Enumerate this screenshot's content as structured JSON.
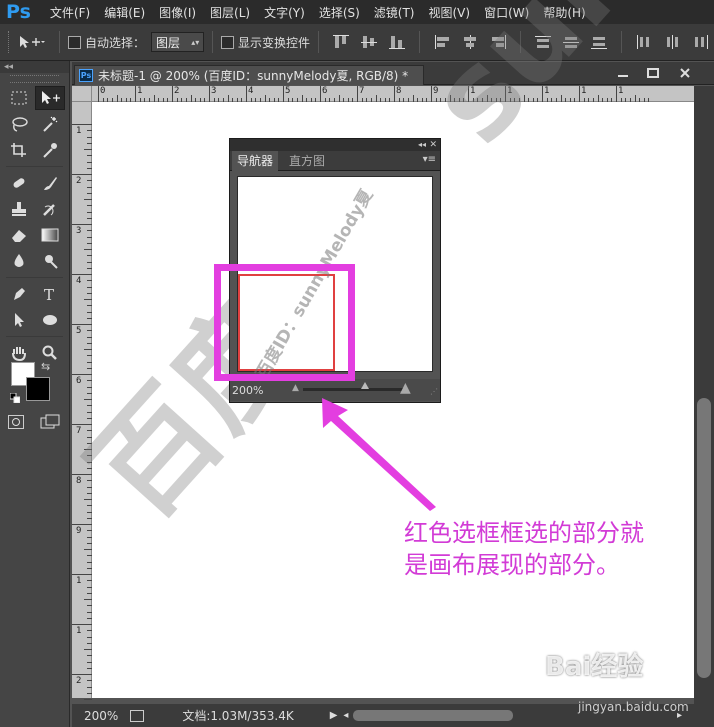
{
  "app": {
    "logo": "Ps"
  },
  "menu": {
    "items": [
      "文件(F)",
      "编辑(E)",
      "图像(I)",
      "图层(L)",
      "文字(Y)",
      "选择(S)",
      "滤镜(T)",
      "视图(V)",
      "窗口(W)",
      "帮助(H)"
    ]
  },
  "options": {
    "auto_select_label": "自动选择：",
    "auto_select_value": "图层",
    "show_transform_label": "显示变换控件"
  },
  "toolbar": {
    "collapse_label": "◂◂"
  },
  "document": {
    "tab_icon": "Ps",
    "title": "未标题-1 @ 200% (百度ID：sunnyMelody夏, RGB/8) *",
    "zoom": "200%",
    "doc_info": "文档:1.03M/353.4K",
    "ruler_h_labels": [
      "0",
      "1",
      "2",
      "3",
      "4",
      "5",
      "6",
      "7",
      "8",
      "9",
      "1",
      "1",
      "1",
      "1",
      "1"
    ],
    "ruler_v_labels": [
      "1",
      "2",
      "3",
      "4",
      "5",
      "6",
      "7",
      "8",
      "9",
      "1",
      "1",
      "2"
    ]
  },
  "navigator": {
    "tab_active": "导航器",
    "tab_inactive": "直方图",
    "zoom_value": "200%",
    "viewbox_color": "#e04040"
  },
  "annotation": {
    "text_line1": "红色选框框选的部分就",
    "text_line2": "是画布展现的部分。",
    "color": "#e33ee0"
  },
  "watermark": {
    "canvas_text": "百度ID：sunnyMelody夏",
    "nav_text": "百度ID：sunnyMelody夏",
    "site_logo": "Bai经验",
    "site_url": "jingyan.baidu.com"
  }
}
